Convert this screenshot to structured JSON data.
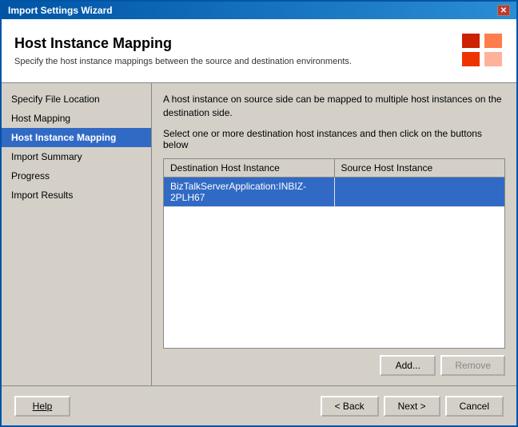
{
  "window": {
    "title": "Import Settings Wizard",
    "close_label": "✕"
  },
  "header": {
    "title": "Host Instance Mapping",
    "description": "Specify the host instance mappings between the source and destination environments."
  },
  "sidebar": {
    "items": [
      {
        "id": "specify-file-location",
        "label": "Specify File Location",
        "active": false
      },
      {
        "id": "host-mapping",
        "label": "Host Mapping",
        "active": false
      },
      {
        "id": "host-instance-mapping",
        "label": "Host Instance Mapping",
        "active": true
      },
      {
        "id": "import-summary",
        "label": "Import Summary",
        "active": false
      },
      {
        "id": "progress",
        "label": "Progress",
        "active": false
      },
      {
        "id": "import-results",
        "label": "Import Results",
        "active": false
      }
    ]
  },
  "content": {
    "description": "A host instance on source side can be mapped to multiple host instances on the destination side.",
    "instruction": "Select one or more destination host instances and then click on the buttons below",
    "table": {
      "columns": [
        {
          "id": "destination",
          "label": "Destination Host Instance"
        },
        {
          "id": "source",
          "label": "Source Host Instance"
        }
      ],
      "rows": [
        {
          "destination": "BizTalkServerApplication:INBIZ-2PLH67",
          "source": "",
          "selected": true
        }
      ]
    },
    "buttons": {
      "add_label": "Add...",
      "remove_label": "Remove"
    }
  },
  "footer": {
    "help_label": "Help",
    "back_label": "< Back",
    "next_label": "Next >",
    "cancel_label": "Cancel"
  }
}
